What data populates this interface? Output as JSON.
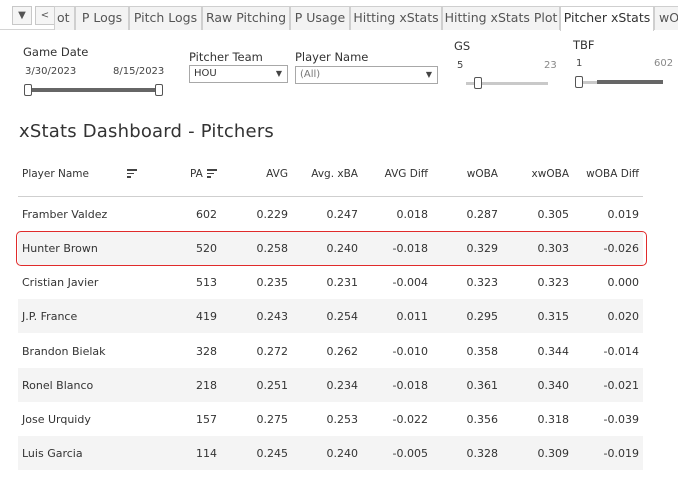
{
  "tabs": {
    "menu_glyph": "▼",
    "prev_glyph": "<",
    "items": [
      {
        "label": "ot"
      },
      {
        "label": "P Logs"
      },
      {
        "label": "Pitch Logs"
      },
      {
        "label": "Raw Pitching"
      },
      {
        "label": "P Usage"
      },
      {
        "label": "Hitting xStats"
      },
      {
        "label": "Hitting xStats Plot"
      },
      {
        "label": "Pitcher xStats",
        "active": true
      },
      {
        "label": "wO"
      }
    ]
  },
  "filters": {
    "game_date": {
      "label": "Game Date",
      "start": "3/30/2023",
      "end": "8/15/2023"
    },
    "pitcher_team": {
      "label": "Pitcher Team",
      "value": "HOU"
    },
    "player_name": {
      "label": "Player Name",
      "value": "(All)"
    },
    "gs": {
      "label": "GS",
      "min": "5",
      "max": "23"
    },
    "tbf": {
      "label": "TBF",
      "min": "1",
      "max": "602"
    }
  },
  "dashboard": {
    "title": "xStats Dashboard - Pitchers"
  },
  "table": {
    "columns": [
      "Player Name",
      "PA",
      "AVG",
      "Avg. xBA",
      "AVG Diff",
      "wOBA",
      "xwOBA",
      "wOBA Diff"
    ],
    "rows": [
      [
        "Framber Valdez",
        "602",
        "0.229",
        "0.247",
        "0.018",
        "0.287",
        "0.305",
        "0.019"
      ],
      [
        "Hunter Brown",
        "520",
        "0.258",
        "0.240",
        "-0.018",
        "0.329",
        "0.303",
        "-0.026"
      ],
      [
        "Cristian Javier",
        "513",
        "0.235",
        "0.231",
        "-0.004",
        "0.323",
        "0.323",
        "0.000"
      ],
      [
        "J.P. France",
        "419",
        "0.243",
        "0.254",
        "0.011",
        "0.295",
        "0.315",
        "0.020"
      ],
      [
        "Brandon Bielak",
        "328",
        "0.272",
        "0.262",
        "-0.010",
        "0.358",
        "0.344",
        "-0.014"
      ],
      [
        "Ronel Blanco",
        "218",
        "0.251",
        "0.234",
        "-0.018",
        "0.361",
        "0.340",
        "-0.021"
      ],
      [
        "Jose Urquidy",
        "157",
        "0.275",
        "0.253",
        "-0.022",
        "0.356",
        "0.318",
        "-0.039"
      ],
      [
        "Luis Garcia",
        "114",
        "0.245",
        "0.240",
        "-0.005",
        "0.328",
        "0.309",
        "-0.019"
      ]
    ],
    "highlighted_row": 1
  },
  "colors": {
    "highlight_border": "#e02b2b",
    "alt_row": "#f4f4f4"
  }
}
